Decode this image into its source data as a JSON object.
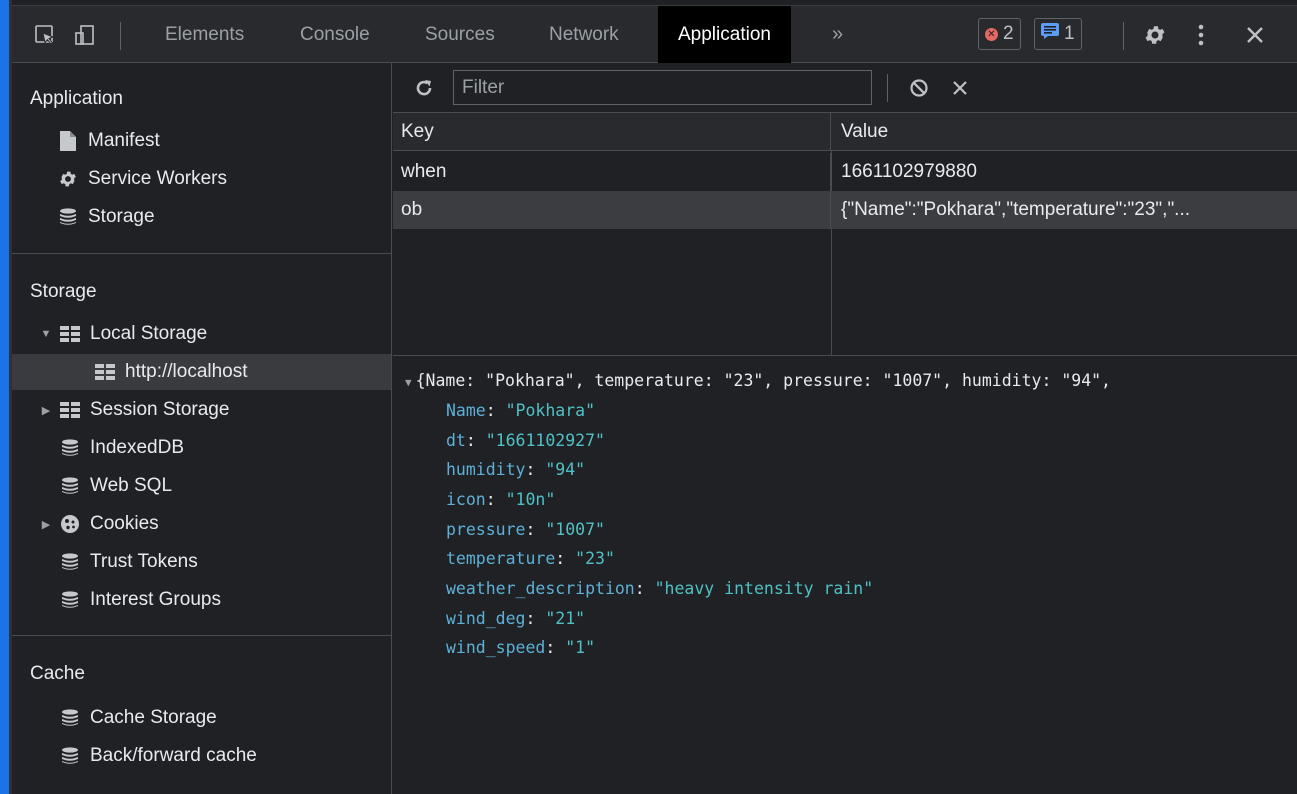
{
  "toolbar": {
    "tabs": [
      "Elements",
      "Console",
      "Sources",
      "Network",
      "Application"
    ],
    "more": "»",
    "errors_count": "2",
    "messages_count": "1"
  },
  "sidebar": {
    "application_header": "Application",
    "application_items": [
      "Manifest",
      "Service Workers",
      "Storage"
    ],
    "storage_header": "Storage",
    "storage_items": [
      "Local Storage",
      "http://localhost",
      "Session Storage",
      "IndexedDB",
      "Web SQL",
      "Cookies",
      "Trust Tokens",
      "Interest Groups"
    ],
    "cache_header": "Cache",
    "cache_items": [
      "Cache Storage",
      "Back/forward cache"
    ]
  },
  "filter": {
    "placeholder": "Filter"
  },
  "table": {
    "headers": [
      "Key",
      "Value"
    ],
    "rows": [
      {
        "key": "when",
        "value": "1661102979880"
      },
      {
        "key": "ob",
        "value": "{\"Name\":\"Pokhara\",\"temperature\":\"23\",\"..."
      }
    ]
  },
  "preview": {
    "summary": "{Name: \"Pokhara\", temperature: \"23\", pressure: \"1007\", humidity: \"94\",",
    "props": [
      {
        "k": "Name",
        "v": "\"Pokhara\""
      },
      {
        "k": "dt",
        "v": "\"1661102927\""
      },
      {
        "k": "humidity",
        "v": "\"94\""
      },
      {
        "k": "icon",
        "v": "\"10n\""
      },
      {
        "k": "pressure",
        "v": "\"1007\""
      },
      {
        "k": "temperature",
        "v": "\"23\""
      },
      {
        "k": "weather_description",
        "v": "\"heavy intensity rain\""
      },
      {
        "k": "wind_deg",
        "v": "\"21\""
      },
      {
        "k": "wind_speed",
        "v": "\"1\""
      }
    ]
  }
}
